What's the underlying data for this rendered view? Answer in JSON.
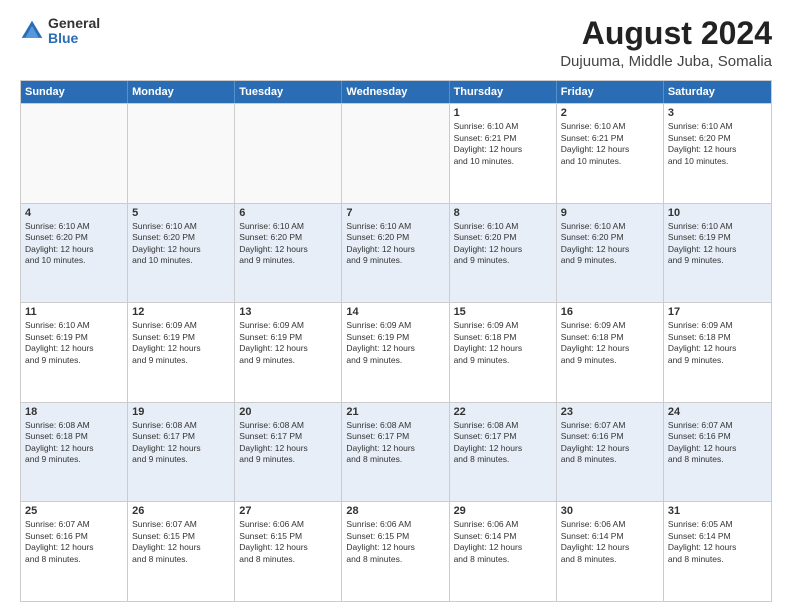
{
  "logo": {
    "general": "General",
    "blue": "Blue"
  },
  "title": "August 2024",
  "subtitle": "Dujuuma, Middle Juba, Somalia",
  "days_of_week": [
    "Sunday",
    "Monday",
    "Tuesday",
    "Wednesday",
    "Thursday",
    "Friday",
    "Saturday"
  ],
  "weeks": [
    [
      {
        "day": "",
        "info": ""
      },
      {
        "day": "",
        "info": ""
      },
      {
        "day": "",
        "info": ""
      },
      {
        "day": "",
        "info": ""
      },
      {
        "day": "1",
        "info": "Sunrise: 6:10 AM\nSunset: 6:21 PM\nDaylight: 12 hours\nand 10 minutes."
      },
      {
        "day": "2",
        "info": "Sunrise: 6:10 AM\nSunset: 6:21 PM\nDaylight: 12 hours\nand 10 minutes."
      },
      {
        "day": "3",
        "info": "Sunrise: 6:10 AM\nSunset: 6:20 PM\nDaylight: 12 hours\nand 10 minutes."
      }
    ],
    [
      {
        "day": "4",
        "info": "Sunrise: 6:10 AM\nSunset: 6:20 PM\nDaylight: 12 hours\nand 10 minutes."
      },
      {
        "day": "5",
        "info": "Sunrise: 6:10 AM\nSunset: 6:20 PM\nDaylight: 12 hours\nand 10 minutes."
      },
      {
        "day": "6",
        "info": "Sunrise: 6:10 AM\nSunset: 6:20 PM\nDaylight: 12 hours\nand 9 minutes."
      },
      {
        "day": "7",
        "info": "Sunrise: 6:10 AM\nSunset: 6:20 PM\nDaylight: 12 hours\nand 9 minutes."
      },
      {
        "day": "8",
        "info": "Sunrise: 6:10 AM\nSunset: 6:20 PM\nDaylight: 12 hours\nand 9 minutes."
      },
      {
        "day": "9",
        "info": "Sunrise: 6:10 AM\nSunset: 6:20 PM\nDaylight: 12 hours\nand 9 minutes."
      },
      {
        "day": "10",
        "info": "Sunrise: 6:10 AM\nSunset: 6:19 PM\nDaylight: 12 hours\nand 9 minutes."
      }
    ],
    [
      {
        "day": "11",
        "info": "Sunrise: 6:10 AM\nSunset: 6:19 PM\nDaylight: 12 hours\nand 9 minutes."
      },
      {
        "day": "12",
        "info": "Sunrise: 6:09 AM\nSunset: 6:19 PM\nDaylight: 12 hours\nand 9 minutes."
      },
      {
        "day": "13",
        "info": "Sunrise: 6:09 AM\nSunset: 6:19 PM\nDaylight: 12 hours\nand 9 minutes."
      },
      {
        "day": "14",
        "info": "Sunrise: 6:09 AM\nSunset: 6:19 PM\nDaylight: 12 hours\nand 9 minutes."
      },
      {
        "day": "15",
        "info": "Sunrise: 6:09 AM\nSunset: 6:18 PM\nDaylight: 12 hours\nand 9 minutes."
      },
      {
        "day": "16",
        "info": "Sunrise: 6:09 AM\nSunset: 6:18 PM\nDaylight: 12 hours\nand 9 minutes."
      },
      {
        "day": "17",
        "info": "Sunrise: 6:09 AM\nSunset: 6:18 PM\nDaylight: 12 hours\nand 9 minutes."
      }
    ],
    [
      {
        "day": "18",
        "info": "Sunrise: 6:08 AM\nSunset: 6:18 PM\nDaylight: 12 hours\nand 9 minutes."
      },
      {
        "day": "19",
        "info": "Sunrise: 6:08 AM\nSunset: 6:17 PM\nDaylight: 12 hours\nand 9 minutes."
      },
      {
        "day": "20",
        "info": "Sunrise: 6:08 AM\nSunset: 6:17 PM\nDaylight: 12 hours\nand 9 minutes."
      },
      {
        "day": "21",
        "info": "Sunrise: 6:08 AM\nSunset: 6:17 PM\nDaylight: 12 hours\nand 8 minutes."
      },
      {
        "day": "22",
        "info": "Sunrise: 6:08 AM\nSunset: 6:17 PM\nDaylight: 12 hours\nand 8 minutes."
      },
      {
        "day": "23",
        "info": "Sunrise: 6:07 AM\nSunset: 6:16 PM\nDaylight: 12 hours\nand 8 minutes."
      },
      {
        "day": "24",
        "info": "Sunrise: 6:07 AM\nSunset: 6:16 PM\nDaylight: 12 hours\nand 8 minutes."
      }
    ],
    [
      {
        "day": "25",
        "info": "Sunrise: 6:07 AM\nSunset: 6:16 PM\nDaylight: 12 hours\nand 8 minutes."
      },
      {
        "day": "26",
        "info": "Sunrise: 6:07 AM\nSunset: 6:15 PM\nDaylight: 12 hours\nand 8 minutes."
      },
      {
        "day": "27",
        "info": "Sunrise: 6:06 AM\nSunset: 6:15 PM\nDaylight: 12 hours\nand 8 minutes."
      },
      {
        "day": "28",
        "info": "Sunrise: 6:06 AM\nSunset: 6:15 PM\nDaylight: 12 hours\nand 8 minutes."
      },
      {
        "day": "29",
        "info": "Sunrise: 6:06 AM\nSunset: 6:14 PM\nDaylight: 12 hours\nand 8 minutes."
      },
      {
        "day": "30",
        "info": "Sunrise: 6:06 AM\nSunset: 6:14 PM\nDaylight: 12 hours\nand 8 minutes."
      },
      {
        "day": "31",
        "info": "Sunrise: 6:05 AM\nSunset: 6:14 PM\nDaylight: 12 hours\nand 8 minutes."
      }
    ]
  ],
  "colors": {
    "header_bg": "#2a6db5",
    "alt_row": "#e8eef7",
    "normal_row": "#ffffff"
  }
}
